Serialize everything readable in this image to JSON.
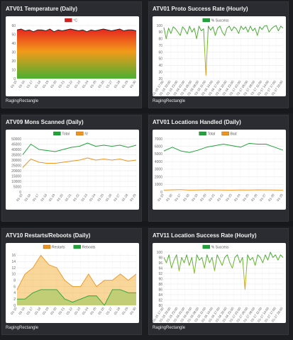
{
  "panels": [
    {
      "title": "ATV01 Temperature (Daily)",
      "footer": "RagingRectangle",
      "chart": {
        "type": "area",
        "legend": [
          "°C"
        ],
        "legend_colors": [
          "#d62020"
        ],
        "ylim": [
          0,
          60
        ],
        "yticks": [
          "0",
          "10",
          "20",
          "30",
          "40",
          "50",
          "60"
        ],
        "xticks": [
          "01-15",
          "01-16",
          "01-17",
          "01-18",
          "01-19",
          "01-20",
          "01-21",
          "01-22",
          "01-23",
          "01-24",
          "01-25",
          "01-26",
          "01-27",
          "01-28",
          "01-29",
          "01-30"
        ],
        "series": [
          {
            "name": "°C",
            "values": [
              55,
              56,
              54,
              55,
              53,
              55,
              55,
              54,
              56,
              53,
              55,
              54,
              55,
              56,
              55,
              54,
              55,
              53,
              55,
              54,
              55,
              56,
              55,
              54,
              55,
              56,
              54,
              55,
              55,
              54
            ]
          }
        ]
      }
    },
    {
      "title": "ATV01 Proto Success Rate (Hourly)",
      "footer": "RagingRectangle",
      "chart": {
        "type": "line",
        "legend": [
          "% Success"
        ],
        "legend_colors": [
          "#22a33a"
        ],
        "ylim": [
          20,
          100
        ],
        "yticks": [
          "20",
          "30",
          "40",
          "50",
          "60",
          "70",
          "80",
          "90",
          "100"
        ],
        "xticks": [
          "01-15 17:00",
          "01-15 20:00",
          "01-15 23:00",
          "01-16 02:00",
          "01-16 05:00",
          "01-16 08:00",
          "01-16 11:00",
          "01-16 14:00",
          "01-16 17:00",
          "01-16 20:00",
          "01-16 23:00",
          "01-17 02:00",
          "01-17 05:00",
          "01-17 08:00",
          "01-17 11:00",
          "01-17 14:00",
          "01-17 17:00",
          "01-17 20:00"
        ],
        "series": [
          {
            "name": "% Success",
            "values": [
              97,
              80,
              96,
              88,
              98,
              95,
              90,
              85,
              98,
              94,
              87,
              99,
              90,
              96,
              80,
              99,
              92,
              95,
              25,
              99,
              93,
              98,
              85,
              96,
              99,
              90,
              85,
              96,
              99,
              92,
              98,
              95,
              88,
              99,
              94,
              98,
              90,
              99,
              92,
              96,
              85,
              98,
              94,
              99,
              100,
              90,
              95,
              98,
              100,
              92,
              99,
              96
            ]
          }
        ]
      }
    },
    {
      "title": "ATV09 Mons Scanned (Daily)",
      "footer": "",
      "chart": {
        "type": "line",
        "legend": [
          "Total",
          "IV"
        ],
        "legend_colors": [
          "#22a33a",
          "#f0941d"
        ],
        "ylim": [
          0,
          50000
        ],
        "yticks": [
          "0",
          "5000",
          "10000",
          "15000",
          "20000",
          "25000",
          "30000",
          "35000",
          "40000",
          "45000",
          "50000"
        ],
        "xticks": [
          "01-15",
          "01-16",
          "01-17",
          "01-18",
          "01-19",
          "01-20",
          "01-21",
          "01-22",
          "01-23",
          "01-24",
          "01-25",
          "01-26",
          "01-27",
          "01-28",
          "01-29"
        ],
        "series": [
          {
            "name": "Total",
            "values": [
              35000,
              45000,
              40000,
              39000,
              38000,
              40000,
              42000,
              43000,
              46000,
              43000,
              44000,
              43000,
              44000,
              42000,
              44000
            ]
          },
          {
            "name": "IV",
            "values": [
              23000,
              31000,
              28000,
              27000,
              27000,
              28000,
              29000,
              30000,
              32000,
              30000,
              31000,
              30000,
              31000,
              29000,
              30000
            ]
          }
        ]
      }
    },
    {
      "title": "ATV01 Locations Handled (Daily)",
      "footer": "",
      "chart": {
        "type": "line",
        "legend": [
          "Total",
          "Bad"
        ],
        "legend_colors": [
          "#22a33a",
          "#f0941d"
        ],
        "ylim": [
          0,
          7000
        ],
        "yticks": [
          "0",
          "1000",
          "2000",
          "3000",
          "4000",
          "5000",
          "6000",
          "7000"
        ],
        "xticks": [
          "01-15",
          "01-16",
          "01-17",
          "01-18",
          "01-19",
          "01-20",
          "01-21",
          "01-22",
          "01-23",
          "01-24",
          "01-25",
          "01-26",
          "01-27",
          "01-28",
          "01-29"
        ],
        "series": [
          {
            "name": "Total",
            "values": [
              5400,
              5900,
              5400,
              5200,
              5500,
              5900,
              6100,
              6300,
              6100,
              5900,
              6400,
              6300,
              6300,
              5900,
              5500
            ]
          },
          {
            "name": "Bad",
            "values": [
              250,
              280,
              300,
              250,
              260,
              280,
              270,
              260,
              250,
              270,
              260,
              280,
              270,
              260,
              250
            ]
          }
        ]
      }
    },
    {
      "title": "ATV10 Restarts/Reboots (Daily)",
      "footer": "RagingRectangle",
      "chart": {
        "type": "area",
        "legend": [
          "Restarts",
          "Reboots"
        ],
        "legend_colors": [
          "#f0941d",
          "#22a33a"
        ],
        "ylim": [
          0,
          17
        ],
        "yticks": [
          "0",
          "2",
          "4",
          "6",
          "8",
          "10",
          "12",
          "14",
          "16"
        ],
        "xticks": [
          "01-15",
          "01-16",
          "01-17",
          "01-18",
          "01-19",
          "01-20",
          "01-21",
          "01-22",
          "01-23",
          "01-24",
          "01-25",
          "01-26",
          "01-27",
          "01-28",
          "01-29",
          "01-30"
        ],
        "series": [
          {
            "name": "Restarts",
            "values": [
              5,
              10,
              12,
              16,
              13,
              12,
              8,
              6,
              6,
              10,
              6,
              8,
              8,
              10,
              8,
              10
            ]
          },
          {
            "name": "Reboots",
            "values": [
              2,
              2,
              4,
              5,
              5,
              5,
              2,
              1,
              2,
              3,
              3,
              0,
              5,
              5,
              4,
              4
            ]
          }
        ]
      }
    },
    {
      "title": "ATV11 Location Success Rate (Hourly)",
      "footer": "RagingRectangle",
      "chart": {
        "type": "line",
        "legend": [
          "% Success"
        ],
        "legend_colors": [
          "#22a33a"
        ],
        "ylim": [
          80,
          100
        ],
        "yticks": [
          "80",
          "82",
          "84",
          "86",
          "88",
          "90",
          "92",
          "94",
          "96",
          "98",
          "100"
        ],
        "xticks": [
          "01-15 17:00",
          "01-15 20:00",
          "01-15 23:00",
          "01-16 02:00",
          "01-16 05:00",
          "01-16 08:00",
          "01-16 11:00",
          "01-16 14:00",
          "01-16 17:00",
          "01-16 20:00",
          "01-16 23:00",
          "01-17 02:00",
          "01-17 05:00",
          "01-17 08:00",
          "01-17 11:00",
          "01-17 14:00",
          "01-17 17:00",
          "01-17 20:00"
        ],
        "series": [
          {
            "name": "% Success",
            "values": [
              98,
              96,
              99,
              94,
              97,
              99,
              93,
              98,
              96,
              99,
              95,
              98,
              92,
              99,
              97,
              98,
              94,
              99,
              96,
              98,
              93,
              99,
              97,
              95,
              98,
              99,
              96,
              94,
              98,
              99,
              96,
              98,
              86,
              99,
              97,
              98,
              95,
              99,
              98,
              96,
              99,
              97,
              100,
              98,
              99,
              97,
              99,
              98
            ]
          }
        ]
      }
    }
  ]
}
